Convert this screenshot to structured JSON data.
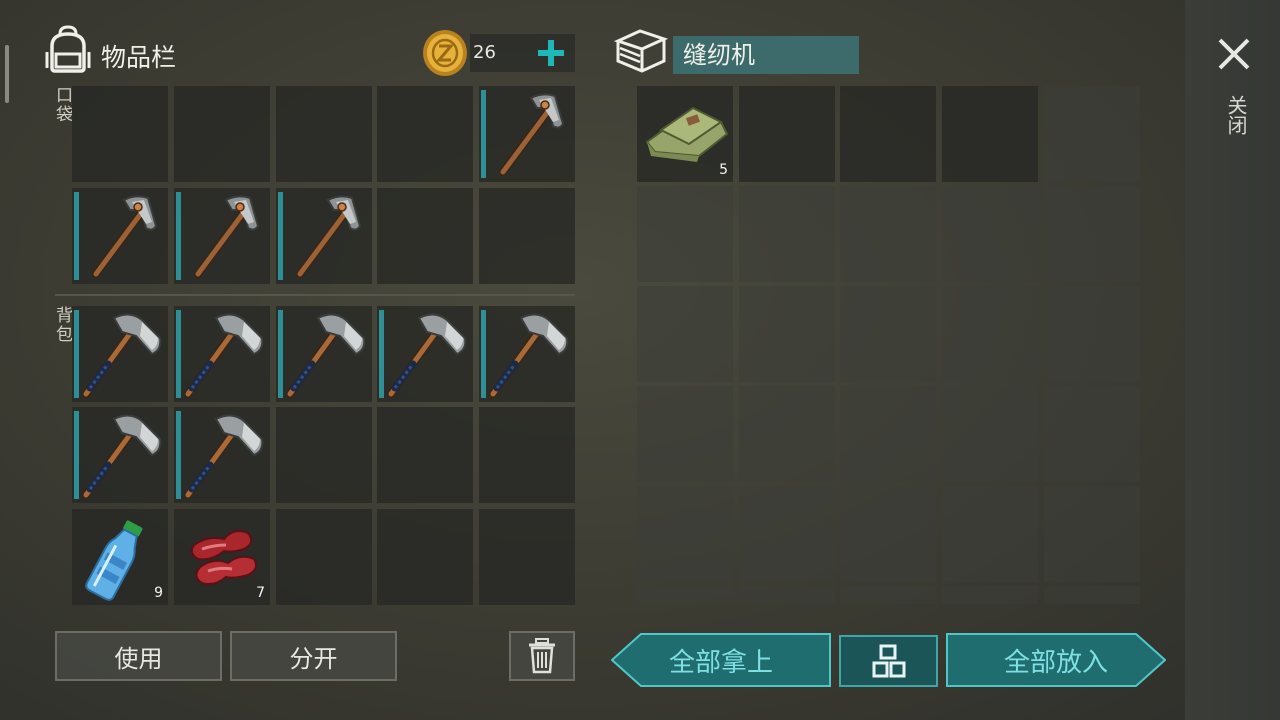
{
  "inventory": {
    "title": "物品栏",
    "coins": "26",
    "pockets_label": "口袋",
    "backpack_label": "背包",
    "pockets": [
      {
        "item": "empty"
      },
      {
        "item": "empty"
      },
      {
        "item": "empty"
      },
      {
        "item": "empty"
      },
      {
        "item": "crude-pickaxe",
        "durability": true
      },
      {
        "item": "crude-pickaxe",
        "durability": true
      },
      {
        "item": "crude-pickaxe",
        "durability": true
      },
      {
        "item": "crude-pickaxe",
        "durability": true
      },
      {
        "item": "empty"
      },
      {
        "item": "empty"
      }
    ],
    "backpack": [
      {
        "item": "hatchet",
        "durability": true
      },
      {
        "item": "hatchet",
        "durability": true
      },
      {
        "item": "hatchet",
        "durability": true
      },
      {
        "item": "hatchet",
        "durability": true
      },
      {
        "item": "hatchet",
        "durability": true
      },
      {
        "item": "hatchet",
        "durability": true
      },
      {
        "item": "hatchet",
        "durability": true
      },
      {
        "item": "empty"
      },
      {
        "item": "empty"
      },
      {
        "item": "empty"
      },
      {
        "item": "water-bottle",
        "count": "9"
      },
      {
        "item": "raw-meat",
        "count": "7"
      },
      {
        "item": "empty"
      },
      {
        "item": "empty"
      },
      {
        "item": "empty"
      }
    ],
    "use_button": "使用",
    "split_button": "分开"
  },
  "container": {
    "name": "缝纫机",
    "first_item": {
      "item": "cloth",
      "count": "5"
    },
    "take_all_button": "全部拿上",
    "put_all_button": "全部放入"
  },
  "close_label": "关闭",
  "colors": {
    "accent_teal": "#2f8f96",
    "button_teal": "#1f6d6e",
    "button_text": "#7fe0e3",
    "plus": "#1fb8b8"
  }
}
